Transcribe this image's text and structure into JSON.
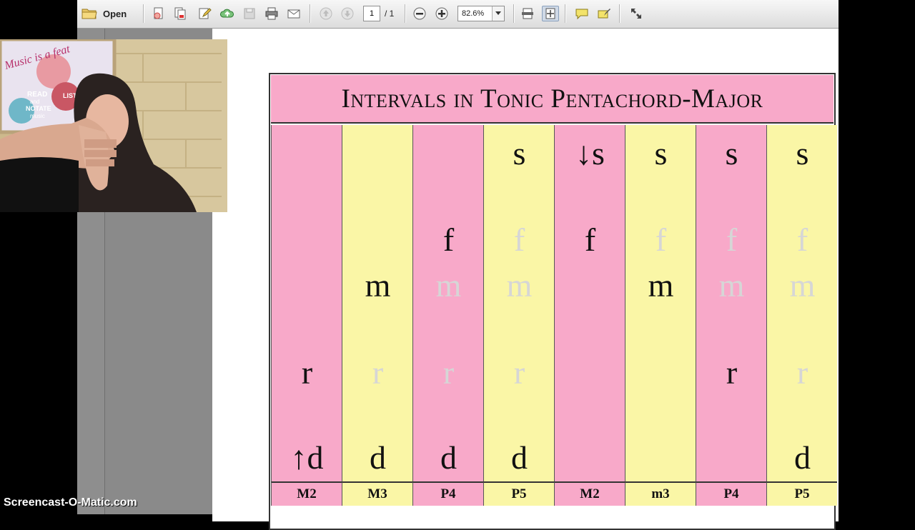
{
  "toolbar": {
    "open_label": "Open",
    "page_current": "1",
    "page_total": "/ 1",
    "zoom": "82.6%"
  },
  "slide": {
    "title": "Intervals in Tonic Pentachord-Major",
    "columns": [
      {
        "label": "M2",
        "bg": "#f8a9c9",
        "s": {
          "t": "",
          "g": false
        },
        "f": {
          "t": "",
          "g": false
        },
        "m": {
          "t": "",
          "g": false
        },
        "r": {
          "t": "r",
          "g": false
        },
        "d": {
          "t": "↑d",
          "g": false
        }
      },
      {
        "label": "M3",
        "bg": "#faf6a6",
        "s": {
          "t": "",
          "g": false
        },
        "f": {
          "t": "",
          "g": false
        },
        "m": {
          "t": "m",
          "g": false
        },
        "r": {
          "t": "r",
          "g": true
        },
        "d": {
          "t": "d",
          "g": false
        }
      },
      {
        "label": "P4",
        "bg": "#f8a9c9",
        "s": {
          "t": "",
          "g": false
        },
        "f": {
          "t": "f",
          "g": false
        },
        "m": {
          "t": "m",
          "g": true
        },
        "r": {
          "t": "r",
          "g": true
        },
        "d": {
          "t": "d",
          "g": false
        }
      },
      {
        "label": "P5",
        "bg": "#faf6a6",
        "s": {
          "t": "s",
          "g": false
        },
        "f": {
          "t": "f",
          "g": true
        },
        "m": {
          "t": "m",
          "g": true
        },
        "r": {
          "t": "r",
          "g": true
        },
        "d": {
          "t": "d",
          "g": false
        }
      },
      {
        "label": "M2",
        "bg": "#f8a9c9",
        "s": {
          "t": "↓s",
          "g": false
        },
        "f": {
          "t": "f",
          "g": false
        },
        "m": {
          "t": "",
          "g": false
        },
        "r": {
          "t": "",
          "g": false
        },
        "d": {
          "t": "",
          "g": false
        }
      },
      {
        "label": "m3",
        "bg": "#faf6a6",
        "s": {
          "t": "s",
          "g": false
        },
        "f": {
          "t": "f",
          "g": true
        },
        "m": {
          "t": "m",
          "g": false
        },
        "r": {
          "t": "",
          "g": false
        },
        "d": {
          "t": "",
          "g": false
        }
      },
      {
        "label": "P4",
        "bg": "#f8a9c9",
        "s": {
          "t": "s",
          "g": false
        },
        "f": {
          "t": "f",
          "g": true
        },
        "m": {
          "t": "m",
          "g": true
        },
        "r": {
          "t": "r",
          "g": false
        },
        "d": {
          "t": "",
          "g": false
        }
      },
      {
        "label": "P5",
        "bg": "#faf6a6",
        "s": {
          "t": "s",
          "g": false
        },
        "f": {
          "t": "f",
          "g": true
        },
        "m": {
          "t": "m",
          "g": true
        },
        "r": {
          "t": "r",
          "g": true
        },
        "d": {
          "t": "d",
          "g": false
        }
      }
    ]
  },
  "webcam": {
    "poster_text": "Music is a feat",
    "poster_words": [
      "READ",
      "and",
      "NOTATE",
      "music",
      "LISTEN"
    ]
  },
  "watermark": "Screencast-O-Matic.com"
}
